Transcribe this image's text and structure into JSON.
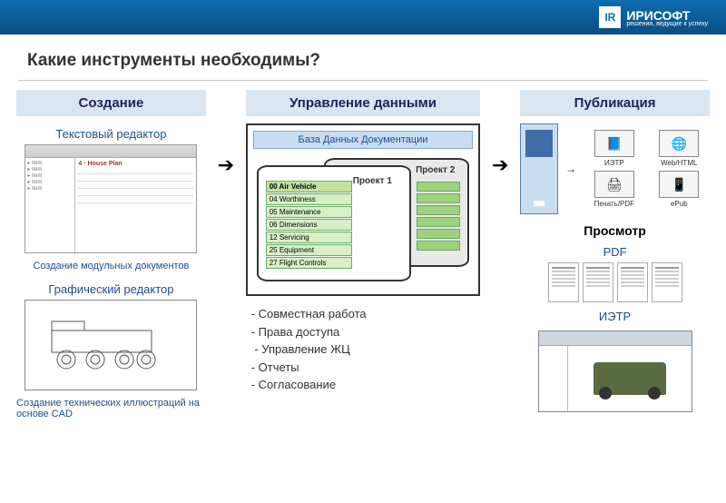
{
  "brand": {
    "short": "IR",
    "name": "ИРИСОФТ",
    "tagline": "решения, ведущие к успеху"
  },
  "title": "Какие инструменты необходимы?",
  "col1": {
    "heading": "Создание",
    "textEditor": "Текстовый редактор",
    "textCaption": "Создание модульных документов",
    "graphEditor": "Графический редактор",
    "graphCaption": "Создание технических иллюстраций на основе CAD"
  },
  "col2": {
    "heading": "Управление данными",
    "dbTitle": "База Данных Документации",
    "project1": "Проект 1",
    "project2": "Проект 2",
    "tree": [
      "00 Air Vehicle",
      "04 Worthiness",
      "05 Maintenance",
      "06 Dimensions",
      "12 Servicing",
      "25 Equipment",
      "27 Flight Controls"
    ],
    "bullets": [
      "Совместная работа",
      "Права доступа",
      " Управление ЖЦ",
      "Отчеты",
      "Согласование"
    ]
  },
  "col3": {
    "heading": "Публикация",
    "outputs": [
      {
        "label": "ИЭТР",
        "icon": "📘"
      },
      {
        "label": "Web/HTML",
        "icon": "🌐"
      },
      {
        "label": "Печать/PDF",
        "icon": "🖨"
      },
      {
        "label": "ePub",
        "icon": "📱"
      }
    ],
    "viewHeading": "Просмотр",
    "pdfLabel": "PDF",
    "ietpLabel": "ИЭТР"
  }
}
